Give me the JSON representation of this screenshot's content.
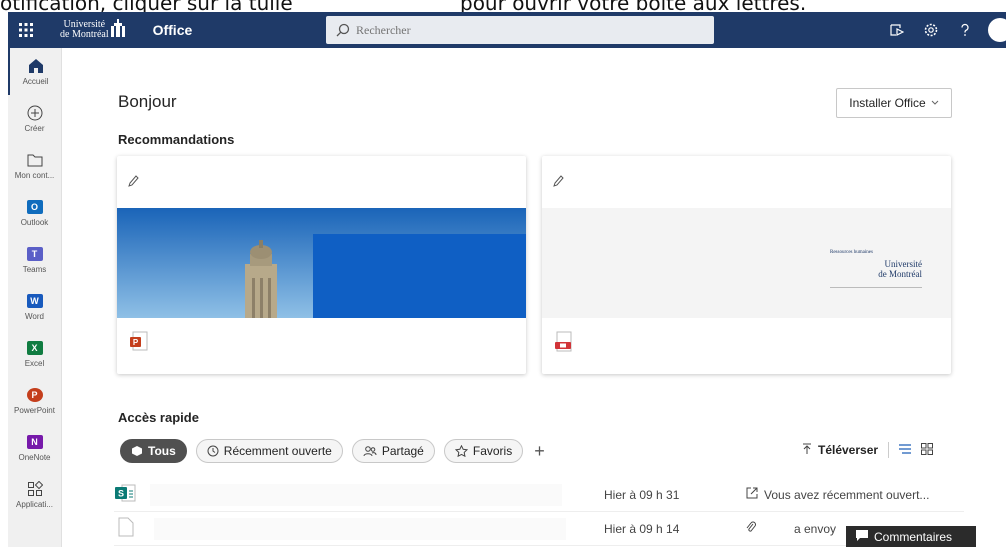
{
  "caption": {
    "left_text": "otification, cliquer sur la tuile",
    "right_text": "pour ouvrir votre boîte aux lettres."
  },
  "topbar": {
    "brand_line1": "Université",
    "brand_line2": "de Montréal",
    "app_name": "Office",
    "search_placeholder": "Rechercher",
    "bg_color": "#1f3a68"
  },
  "rail": {
    "items": [
      {
        "label": "Accueil",
        "icon": "home-icon"
      },
      {
        "label": "Créer",
        "icon": "plus-circle-icon"
      },
      {
        "label": "Mon cont...",
        "icon": "folder-icon"
      },
      {
        "label": "Outlook",
        "icon": "outlook-icon",
        "tile": "O"
      },
      {
        "label": "Teams",
        "icon": "teams-icon",
        "tile": "T"
      },
      {
        "label": "Word",
        "icon": "word-icon",
        "tile": "W"
      },
      {
        "label": "Excel",
        "icon": "excel-icon",
        "tile": "X"
      },
      {
        "label": "PowerPoint",
        "icon": "powerpoint-icon",
        "tile": "P"
      },
      {
        "label": "OneNote",
        "icon": "onenote-icon",
        "tile": "N"
      },
      {
        "label": "Applicati...",
        "icon": "apps-icon"
      }
    ]
  },
  "main": {
    "greeting": "Bonjour",
    "install_label": "Installer Office",
    "recommendations_title": "Recommandations",
    "card2_logo_small": "Ressources humaines",
    "card2_logo_line1": "Université",
    "card2_logo_line2": "de Montréal",
    "quick_access_title": "Accès rapide",
    "filters": {
      "all": "Tous",
      "recent": "Récemment ouverte",
      "shared": "Partagé",
      "favorites": "Favoris"
    },
    "upload_label": "Téléverser",
    "rows": [
      {
        "date": "Hier à 09 h 31",
        "activity": "Vous avez récemment ouvert..."
      },
      {
        "date": "Hier à 09 h 14",
        "activity": "a envoy"
      }
    ],
    "feedback_label": "Commentaires"
  }
}
